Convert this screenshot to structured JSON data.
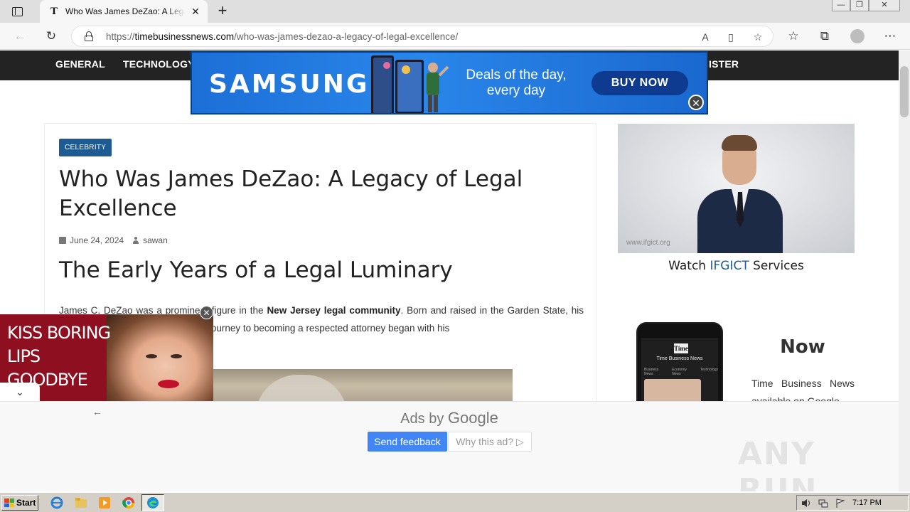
{
  "browser": {
    "tab_title": "Who Was James DeZao: A Legacy of Legal Excellence",
    "tab_favicon": "T",
    "tab_close": "✕",
    "new_tab": "+",
    "url_scheme": "https://",
    "url_host": "timebusinessnews.com",
    "url_path": "/who-was-james-dezao-a-legacy-of-legal-excellence/"
  },
  "site_nav": {
    "items": [
      "GENERAL",
      "TECHNOLOGY",
      "ISTER"
    ]
  },
  "top_ad": {
    "brand": "SAMSUNG",
    "headline": "Deals of the day, every day",
    "cta": "BUY NOW",
    "close": "✕"
  },
  "article": {
    "category": "CELEBRITY",
    "title": "Who Was James DeZao: A Legacy of Legal Excellence",
    "date": "June 24, 2024",
    "author": "sawan",
    "section_heading": "The Early Years of a Legal Luminary",
    "paragraph_start": "James C. DeZao was a prominent figure in the ",
    "paragraph_bold": "New Jersey legal community",
    "paragraph_end": ". Born and raised in the Garden State, his passion for justice and the law. His journey to becoming a respected attorney began with his"
  },
  "sidebar": {
    "video_watermark": "www.ifgict.org",
    "caption_prefix": "Watch ",
    "caption_brand": "IFGICT",
    "caption_suffix": " Services",
    "app_logo": "Time",
    "app_name": "Time Business News",
    "app_tabs": [
      "Business News",
      "Economy News",
      "Technology"
    ],
    "now_heading": "Now",
    "promo_text": "Time Business News available on Google"
  },
  "lips_ad": {
    "headline": "KISS BORING LIPS GOODBYE",
    "close": "✕",
    "collapse": "⌄"
  },
  "bottom_ad": {
    "back": "←",
    "ads_by": "Ads by ",
    "google": "Google",
    "send_feedback": "Send feedback",
    "why_ad": "Why this ad? ▷",
    "watermark": "ANY RUN"
  },
  "taskbar": {
    "start": "Start",
    "clock": "7:17 PM"
  },
  "colors": {
    "nav_bg": "#232323",
    "badge": "#1e5b93",
    "samsung_blue": "#1a6fd1",
    "feedback_blue": "#4285f4",
    "lips_red": "#8e1020"
  }
}
